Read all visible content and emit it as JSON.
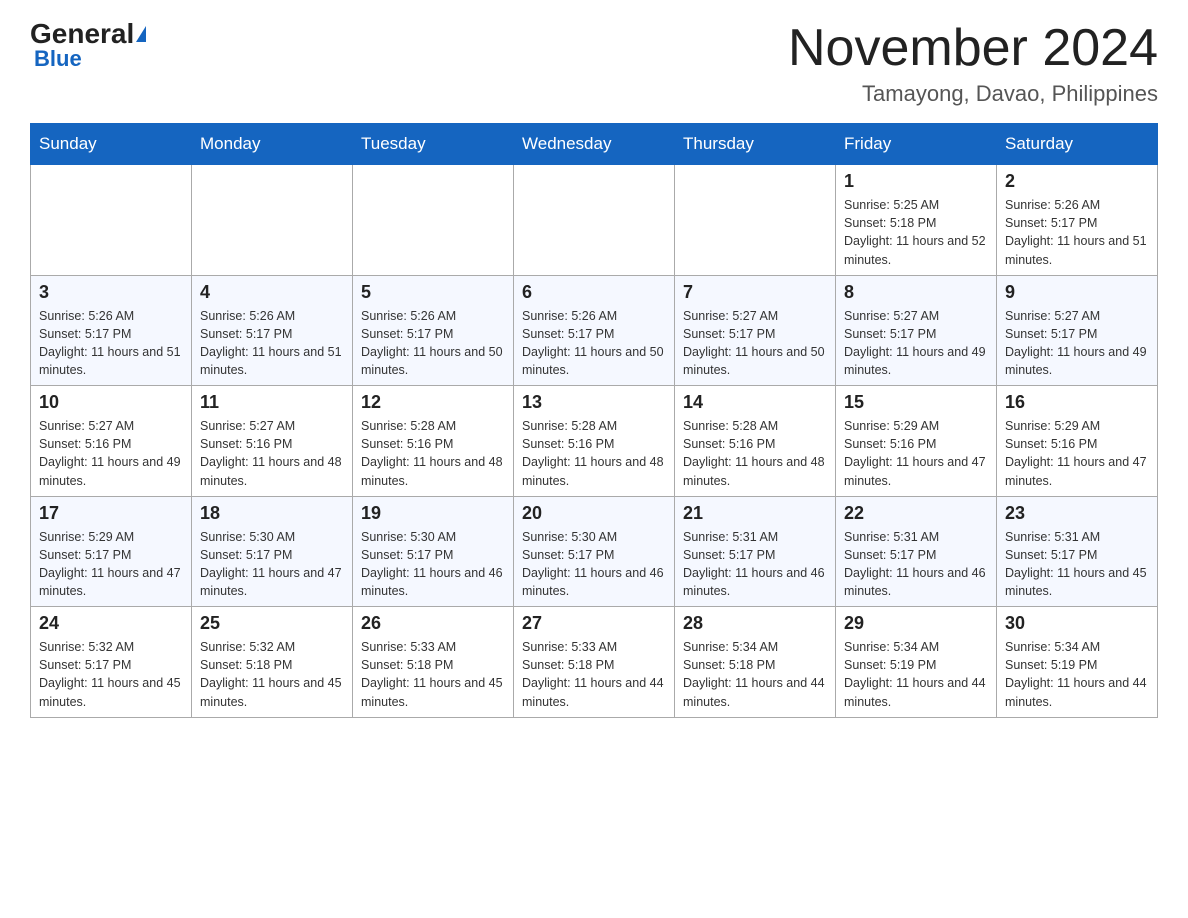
{
  "header": {
    "logo_general": "General",
    "logo_blue": "Blue",
    "month_title": "November 2024",
    "location": "Tamayong, Davao, Philippines"
  },
  "days_of_week": [
    "Sunday",
    "Monday",
    "Tuesday",
    "Wednesday",
    "Thursday",
    "Friday",
    "Saturday"
  ],
  "weeks": [
    [
      {
        "day": "",
        "sunrise": "",
        "sunset": "",
        "daylight": ""
      },
      {
        "day": "",
        "sunrise": "",
        "sunset": "",
        "daylight": ""
      },
      {
        "day": "",
        "sunrise": "",
        "sunset": "",
        "daylight": ""
      },
      {
        "day": "",
        "sunrise": "",
        "sunset": "",
        "daylight": ""
      },
      {
        "day": "",
        "sunrise": "",
        "sunset": "",
        "daylight": ""
      },
      {
        "day": "1",
        "sunrise": "Sunrise: 5:25 AM",
        "sunset": "Sunset: 5:18 PM",
        "daylight": "Daylight: 11 hours and 52 minutes."
      },
      {
        "day": "2",
        "sunrise": "Sunrise: 5:26 AM",
        "sunset": "Sunset: 5:17 PM",
        "daylight": "Daylight: 11 hours and 51 minutes."
      }
    ],
    [
      {
        "day": "3",
        "sunrise": "Sunrise: 5:26 AM",
        "sunset": "Sunset: 5:17 PM",
        "daylight": "Daylight: 11 hours and 51 minutes."
      },
      {
        "day": "4",
        "sunrise": "Sunrise: 5:26 AM",
        "sunset": "Sunset: 5:17 PM",
        "daylight": "Daylight: 11 hours and 51 minutes."
      },
      {
        "day": "5",
        "sunrise": "Sunrise: 5:26 AM",
        "sunset": "Sunset: 5:17 PM",
        "daylight": "Daylight: 11 hours and 50 minutes."
      },
      {
        "day": "6",
        "sunrise": "Sunrise: 5:26 AM",
        "sunset": "Sunset: 5:17 PM",
        "daylight": "Daylight: 11 hours and 50 minutes."
      },
      {
        "day": "7",
        "sunrise": "Sunrise: 5:27 AM",
        "sunset": "Sunset: 5:17 PM",
        "daylight": "Daylight: 11 hours and 50 minutes."
      },
      {
        "day": "8",
        "sunrise": "Sunrise: 5:27 AM",
        "sunset": "Sunset: 5:17 PM",
        "daylight": "Daylight: 11 hours and 49 minutes."
      },
      {
        "day": "9",
        "sunrise": "Sunrise: 5:27 AM",
        "sunset": "Sunset: 5:17 PM",
        "daylight": "Daylight: 11 hours and 49 minutes."
      }
    ],
    [
      {
        "day": "10",
        "sunrise": "Sunrise: 5:27 AM",
        "sunset": "Sunset: 5:16 PM",
        "daylight": "Daylight: 11 hours and 49 minutes."
      },
      {
        "day": "11",
        "sunrise": "Sunrise: 5:27 AM",
        "sunset": "Sunset: 5:16 PM",
        "daylight": "Daylight: 11 hours and 48 minutes."
      },
      {
        "day": "12",
        "sunrise": "Sunrise: 5:28 AM",
        "sunset": "Sunset: 5:16 PM",
        "daylight": "Daylight: 11 hours and 48 minutes."
      },
      {
        "day": "13",
        "sunrise": "Sunrise: 5:28 AM",
        "sunset": "Sunset: 5:16 PM",
        "daylight": "Daylight: 11 hours and 48 minutes."
      },
      {
        "day": "14",
        "sunrise": "Sunrise: 5:28 AM",
        "sunset": "Sunset: 5:16 PM",
        "daylight": "Daylight: 11 hours and 48 minutes."
      },
      {
        "day": "15",
        "sunrise": "Sunrise: 5:29 AM",
        "sunset": "Sunset: 5:16 PM",
        "daylight": "Daylight: 11 hours and 47 minutes."
      },
      {
        "day": "16",
        "sunrise": "Sunrise: 5:29 AM",
        "sunset": "Sunset: 5:16 PM",
        "daylight": "Daylight: 11 hours and 47 minutes."
      }
    ],
    [
      {
        "day": "17",
        "sunrise": "Sunrise: 5:29 AM",
        "sunset": "Sunset: 5:17 PM",
        "daylight": "Daylight: 11 hours and 47 minutes."
      },
      {
        "day": "18",
        "sunrise": "Sunrise: 5:30 AM",
        "sunset": "Sunset: 5:17 PM",
        "daylight": "Daylight: 11 hours and 47 minutes."
      },
      {
        "day": "19",
        "sunrise": "Sunrise: 5:30 AM",
        "sunset": "Sunset: 5:17 PM",
        "daylight": "Daylight: 11 hours and 46 minutes."
      },
      {
        "day": "20",
        "sunrise": "Sunrise: 5:30 AM",
        "sunset": "Sunset: 5:17 PM",
        "daylight": "Daylight: 11 hours and 46 minutes."
      },
      {
        "day": "21",
        "sunrise": "Sunrise: 5:31 AM",
        "sunset": "Sunset: 5:17 PM",
        "daylight": "Daylight: 11 hours and 46 minutes."
      },
      {
        "day": "22",
        "sunrise": "Sunrise: 5:31 AM",
        "sunset": "Sunset: 5:17 PM",
        "daylight": "Daylight: 11 hours and 46 minutes."
      },
      {
        "day": "23",
        "sunrise": "Sunrise: 5:31 AM",
        "sunset": "Sunset: 5:17 PM",
        "daylight": "Daylight: 11 hours and 45 minutes."
      }
    ],
    [
      {
        "day": "24",
        "sunrise": "Sunrise: 5:32 AM",
        "sunset": "Sunset: 5:17 PM",
        "daylight": "Daylight: 11 hours and 45 minutes."
      },
      {
        "day": "25",
        "sunrise": "Sunrise: 5:32 AM",
        "sunset": "Sunset: 5:18 PM",
        "daylight": "Daylight: 11 hours and 45 minutes."
      },
      {
        "day": "26",
        "sunrise": "Sunrise: 5:33 AM",
        "sunset": "Sunset: 5:18 PM",
        "daylight": "Daylight: 11 hours and 45 minutes."
      },
      {
        "day": "27",
        "sunrise": "Sunrise: 5:33 AM",
        "sunset": "Sunset: 5:18 PM",
        "daylight": "Daylight: 11 hours and 44 minutes."
      },
      {
        "day": "28",
        "sunrise": "Sunrise: 5:34 AM",
        "sunset": "Sunset: 5:18 PM",
        "daylight": "Daylight: 11 hours and 44 minutes."
      },
      {
        "day": "29",
        "sunrise": "Sunrise: 5:34 AM",
        "sunset": "Sunset: 5:19 PM",
        "daylight": "Daylight: 11 hours and 44 minutes."
      },
      {
        "day": "30",
        "sunrise": "Sunrise: 5:34 AM",
        "sunset": "Sunset: 5:19 PM",
        "daylight": "Daylight: 11 hours and 44 minutes."
      }
    ]
  ]
}
